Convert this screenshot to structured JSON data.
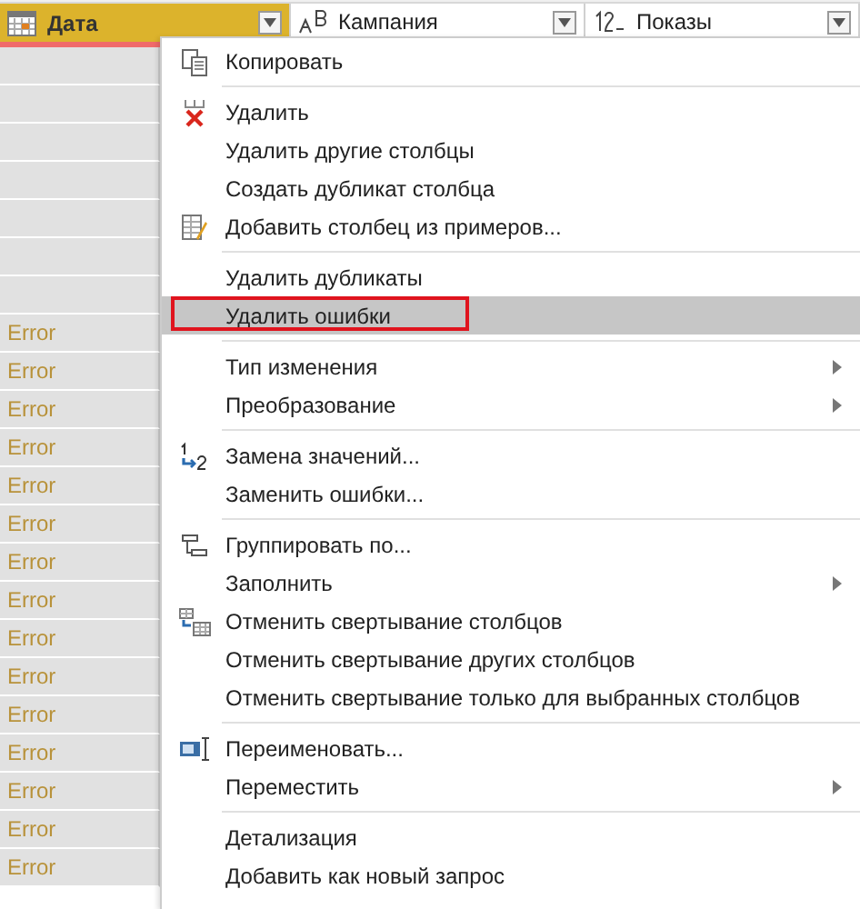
{
  "table": {
    "columns": [
      {
        "name": "Дата",
        "selected": true
      },
      {
        "name": "Кампания",
        "selected": false
      },
      {
        "name": "Показы",
        "selected": false
      }
    ],
    "rows": [
      {
        "value": ""
      },
      {
        "value": ""
      },
      {
        "value": ""
      },
      {
        "value": ""
      },
      {
        "value": ""
      },
      {
        "value": ""
      },
      {
        "value": ""
      },
      {
        "value": "Error"
      },
      {
        "value": "Error"
      },
      {
        "value": "Error"
      },
      {
        "value": "Error"
      },
      {
        "value": "Error"
      },
      {
        "value": "Error"
      },
      {
        "value": "Error"
      },
      {
        "value": "Error"
      },
      {
        "value": "Error"
      },
      {
        "value": "Error"
      },
      {
        "value": "Error"
      },
      {
        "value": "Error"
      },
      {
        "value": "Error"
      },
      {
        "value": "Error"
      },
      {
        "value": "Error"
      }
    ]
  },
  "context_menu": {
    "items": [
      {
        "kind": "copy",
        "label": "Копировать",
        "submenu": false,
        "selected": false,
        "outlined": false
      },
      {
        "kind": "separator"
      },
      {
        "kind": "delete",
        "label": "Удалить",
        "submenu": false,
        "selected": false,
        "outlined": false
      },
      {
        "kind": "item",
        "label": "Удалить другие столбцы",
        "submenu": false,
        "selected": false,
        "outlined": false
      },
      {
        "kind": "item",
        "label": "Создать дубликат столбца",
        "submenu": false,
        "selected": false,
        "outlined": false
      },
      {
        "kind": "examples",
        "label": "Добавить столбец из примеров...",
        "submenu": false,
        "selected": false,
        "outlined": false
      },
      {
        "kind": "separator"
      },
      {
        "kind": "item",
        "label": "Удалить дубликаты",
        "submenu": false,
        "selected": false,
        "outlined": false
      },
      {
        "kind": "item",
        "label": "Удалить ошибки",
        "submenu": false,
        "selected": true,
        "outlined": true
      },
      {
        "kind": "separator"
      },
      {
        "kind": "item",
        "label": "Тип изменения",
        "submenu": true,
        "selected": false,
        "outlined": false
      },
      {
        "kind": "item",
        "label": "Преобразование",
        "submenu": true,
        "selected": false,
        "outlined": false
      },
      {
        "kind": "separator"
      },
      {
        "kind": "replace",
        "label": "Замена значений...",
        "submenu": false,
        "selected": false,
        "outlined": false
      },
      {
        "kind": "item",
        "label": "Заменить ошибки...",
        "submenu": false,
        "selected": false,
        "outlined": false
      },
      {
        "kind": "separator"
      },
      {
        "kind": "group",
        "label": "Группировать по...",
        "submenu": false,
        "selected": false,
        "outlined": false
      },
      {
        "kind": "item",
        "label": "Заполнить",
        "submenu": true,
        "selected": false,
        "outlined": false
      },
      {
        "kind": "unpivot",
        "label": "Отменить свертывание столбцов",
        "submenu": false,
        "selected": false,
        "outlined": false
      },
      {
        "kind": "item",
        "label": "Отменить свертывание других столбцов",
        "submenu": false,
        "selected": false,
        "outlined": false
      },
      {
        "kind": "item",
        "label": "Отменить свертывание только для выбранных столбцов",
        "submenu": false,
        "selected": false,
        "outlined": false
      },
      {
        "kind": "separator"
      },
      {
        "kind": "rename",
        "label": "Переименовать...",
        "submenu": false,
        "selected": false,
        "outlined": false
      },
      {
        "kind": "item",
        "label": "Переместить",
        "submenu": true,
        "selected": false,
        "outlined": false
      },
      {
        "kind": "separator"
      },
      {
        "kind": "item",
        "label": "Детализация",
        "submenu": false,
        "selected": false,
        "outlined": false
      },
      {
        "kind": "item",
        "label": "Добавить как новый запрос",
        "submenu": false,
        "selected": false,
        "outlined": false
      }
    ]
  }
}
